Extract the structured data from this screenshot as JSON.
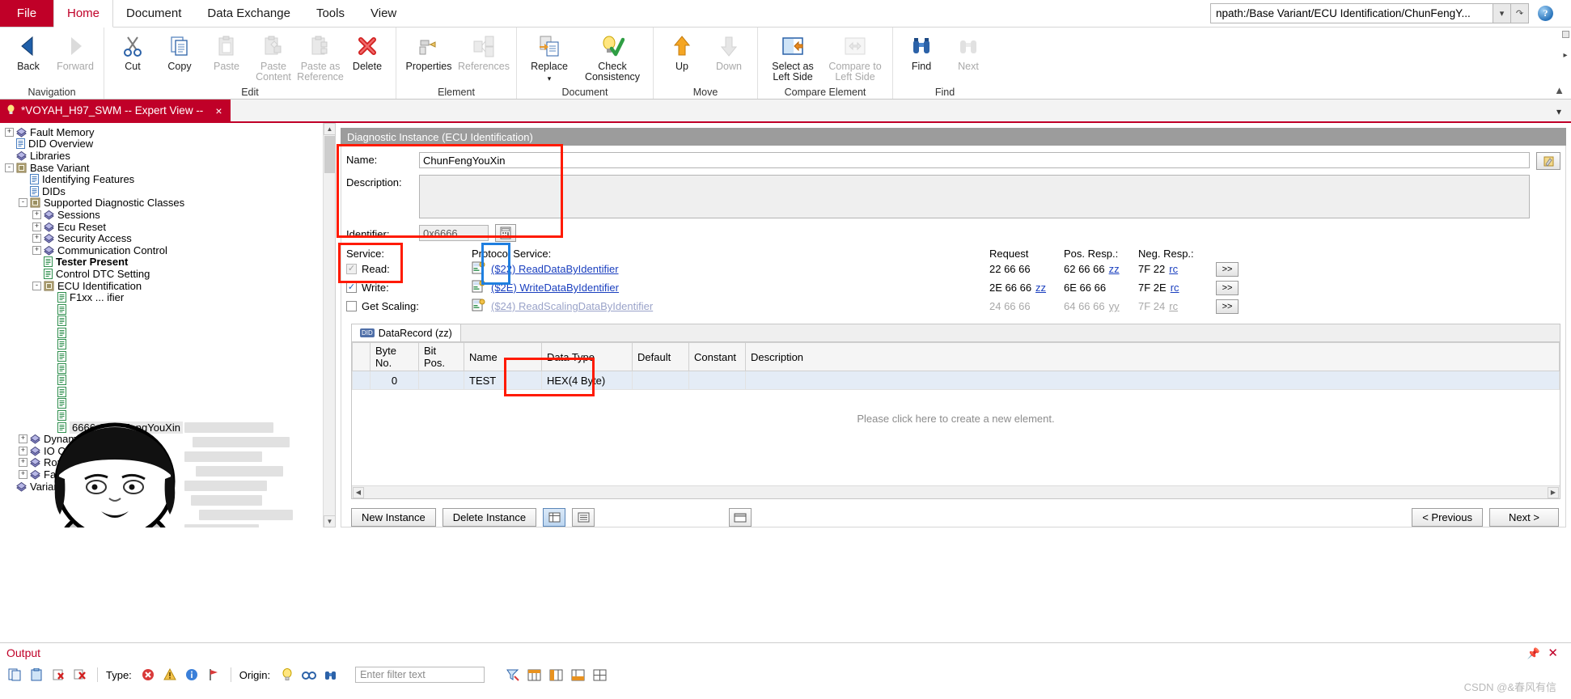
{
  "ribbon": {
    "tabs": [
      {
        "label": "File",
        "type": "file"
      },
      {
        "label": "Home",
        "active": true
      },
      {
        "label": "Document"
      },
      {
        "label": "Data Exchange"
      },
      {
        "label": "Tools"
      },
      {
        "label": "View"
      }
    ],
    "address": {
      "value": "npath:/Base Variant/ECU Identification/ChunFengY...",
      "dropdown_icon": "chevron-down-icon",
      "go_icon": "refresh-icon"
    },
    "help_icon": "help-icon",
    "groups": [
      {
        "title": "Navigation",
        "buttons": [
          {
            "label": "Back",
            "icon": "back-arrow-icon",
            "disabled": false
          },
          {
            "label": "Forward",
            "icon": "forward-arrow-icon",
            "disabled": true
          }
        ]
      },
      {
        "title": "Edit",
        "buttons": [
          {
            "label": "Cut",
            "icon": "scissors-icon",
            "disabled": false
          },
          {
            "label": "Copy",
            "icon": "copy-icon",
            "disabled": false
          },
          {
            "label": "Paste",
            "icon": "paste-icon",
            "disabled": true
          },
          {
            "label": "Paste Content",
            "icon": "paste-content-icon",
            "disabled": true
          },
          {
            "label": "Paste as Reference",
            "icon": "paste-reference-icon",
            "disabled": true
          },
          {
            "label": "Delete",
            "icon": "delete-x-icon",
            "disabled": false
          }
        ]
      },
      {
        "title": "Element",
        "buttons": [
          {
            "label": "Properties",
            "icon": "properties-icon",
            "disabled": false
          },
          {
            "label": "References",
            "icon": "references-icon",
            "disabled": true
          }
        ]
      },
      {
        "title": "Document",
        "buttons": [
          {
            "label": "Replace",
            "icon": "replace-icon",
            "disabled": false,
            "dropdown": true
          },
          {
            "label": "Check Consistency",
            "icon": "check-consistency-icon",
            "disabled": false
          }
        ]
      },
      {
        "title": "Move",
        "buttons": [
          {
            "label": "Up",
            "icon": "arrow-up-icon",
            "disabled": false
          },
          {
            "label": "Down",
            "icon": "arrow-down-icon",
            "disabled": true
          }
        ]
      },
      {
        "title": "Compare Element",
        "buttons": [
          {
            "label": "Select as Left Side",
            "icon": "select-left-icon",
            "disabled": false
          },
          {
            "label": "Compare to Left Side",
            "icon": "compare-left-icon",
            "disabled": true
          }
        ]
      },
      {
        "title": "Find",
        "buttons": [
          {
            "label": "Find",
            "icon": "binoculars-icon",
            "disabled": false
          },
          {
            "label": "Next",
            "icon": "find-next-icon",
            "disabled": true
          }
        ]
      }
    ],
    "collapse_icon": "chevron-up-icon"
  },
  "document_tab": {
    "label": "*VOYAH_H97_SWM -- Expert View --",
    "icon": "bulb-icon",
    "close": "×",
    "overflow_icon": "chevron-down-icon"
  },
  "tree": {
    "items": [
      {
        "label": "Fault Memory",
        "indent": 0,
        "expander": "+",
        "icon": "books-icon"
      },
      {
        "label": "DID Overview",
        "indent": 0,
        "expander": "",
        "icon": "doc-blue-icon"
      },
      {
        "label": "Libraries",
        "indent": 0,
        "expander": "",
        "icon": "books-icon"
      },
      {
        "label": "Base Variant",
        "indent": 0,
        "expander": "-",
        "icon": "variant-icon"
      },
      {
        "label": "Identifying Features",
        "indent": 1,
        "expander": "",
        "icon": "doc-blue-icon"
      },
      {
        "label": "DIDs",
        "indent": 1,
        "expander": "",
        "icon": "doc-blue-icon"
      },
      {
        "label": "Supported Diagnostic Classes",
        "indent": 1,
        "expander": "-",
        "icon": "variant-icon"
      },
      {
        "label": "Sessions",
        "indent": 2,
        "expander": "+",
        "icon": "books-icon"
      },
      {
        "label": "Ecu Reset",
        "indent": 2,
        "expander": "+",
        "icon": "books-icon"
      },
      {
        "label": "Security Access",
        "indent": 2,
        "expander": "+",
        "icon": "books-icon"
      },
      {
        "label": "Communication Control",
        "indent": 2,
        "expander": "+",
        "icon": "books-icon"
      },
      {
        "label": "Tester Present",
        "indent": 2,
        "expander": "",
        "icon": "doc-green-icon",
        "bold": true
      },
      {
        "label": "Control DTC Setting",
        "indent": 2,
        "expander": "",
        "icon": "doc-green-icon"
      },
      {
        "label": "ECU Identification",
        "indent": 2,
        "expander": "-",
        "icon": "variant-icon"
      },
      {
        "label": "F1xx ... ifier",
        "indent": 3,
        "expander": "",
        "icon": "doc-green-icon",
        "obscured": true
      },
      {
        "label": "",
        "indent": 3,
        "expander": "",
        "icon": "doc-green-icon",
        "obscured": true
      },
      {
        "label": "",
        "indent": 3,
        "expander": "",
        "icon": "doc-green-icon",
        "obscured": true
      },
      {
        "label": "",
        "indent": 3,
        "expander": "",
        "icon": "doc-green-icon",
        "obscured": true
      },
      {
        "label": "",
        "indent": 3,
        "expander": "",
        "icon": "doc-green-icon",
        "obscured": true
      },
      {
        "label": "",
        "indent": 3,
        "expander": "",
        "icon": "doc-green-icon",
        "obscured": true
      },
      {
        "label": "",
        "indent": 3,
        "expander": "",
        "icon": "doc-green-icon",
        "obscured": true
      },
      {
        "label": "",
        "indent": 3,
        "expander": "",
        "icon": "doc-green-icon",
        "obscured": true
      },
      {
        "label": "",
        "indent": 3,
        "expander": "",
        "icon": "doc-green-icon",
        "obscured": true
      },
      {
        "label": "",
        "indent": 3,
        "expander": "",
        "icon": "doc-green-icon",
        "obscured": true
      },
      {
        "label": "",
        "indent": 3,
        "expander": "",
        "icon": "doc-green-icon",
        "obscured": true
      },
      {
        "label": "6666 ChunFengYouXin",
        "indent": 3,
        "expander": "",
        "icon": "doc-green-icon",
        "selected": true
      },
      {
        "label": "Dynamic Data",
        "indent": 1,
        "expander": "+",
        "icon": "books-icon"
      },
      {
        "label": "IO Control",
        "indent": 1,
        "expander": "+",
        "icon": "books-icon"
      },
      {
        "label": "Routine Control",
        "indent": 1,
        "expander": "+",
        "icon": "books-icon"
      },
      {
        "label": "Fault Memory",
        "indent": 1,
        "expander": "+",
        "icon": "books-icon"
      },
      {
        "label": "Variants",
        "indent": 0,
        "expander": "",
        "icon": "books-icon"
      }
    ]
  },
  "form": {
    "panel_title": "Diagnostic Instance (ECU Identification)",
    "name_label": "Name:",
    "name_value": "ChunFengYouXin",
    "description_label": "Description:",
    "description_value": "",
    "identifier_label": "Identifier:",
    "identifier_value": "0x6666",
    "identifier_btn_icon": "calculator-icon",
    "edit_icon": "edit-pencil-icon",
    "service_label": "Service:",
    "protocol_service_label": "Protocol Service:",
    "col_request": "Request",
    "col_pos_resp": "Pos. Resp.:",
    "col_neg_resp": "Neg. Resp.:",
    "more_btn": ">>",
    "services": [
      {
        "check_label": "Read:",
        "checked": true,
        "disabled": true,
        "link": "($22) ReadDataByIdentifier",
        "link_icon": "service-read-icon",
        "request": "22  66 66",
        "pos_resp": "62  66 66",
        "pos_suffix": "zz",
        "neg_resp": "7F  22",
        "neg_suffix": "rc",
        "dim": false
      },
      {
        "check_label": "Write:",
        "checked": true,
        "disabled": false,
        "link": "($2E) WriteDataByIdentifier",
        "link_icon": "service-write-icon",
        "request": "2E  66 66",
        "request_suffix": "zz",
        "pos_resp": "6E  66 66",
        "pos_suffix": "",
        "neg_resp": "7F  2E",
        "neg_suffix": "rc",
        "dim": false
      },
      {
        "check_label": "Get Scaling:",
        "checked": false,
        "disabled": false,
        "link": "($24) ReadScalingDataByIdentifier",
        "link_icon": "service-scaling-icon",
        "request": "24  66 66",
        "pos_resp": "64  66 66",
        "pos_suffix": "yy",
        "neg_resp": "7F  24",
        "neg_suffix": "rc",
        "dim": true
      }
    ]
  },
  "datarecord": {
    "tab_label": "DataRecord (zz)",
    "tab_badge": "DID",
    "columns": [
      "",
      "Byte No.",
      "Bit Pos.",
      "Name",
      "Data Type",
      "Default",
      "Constant",
      "Description"
    ],
    "rows": [
      {
        "marker": "",
        "byte_no": "0",
        "bit_pos": "",
        "name": "TEST",
        "data_type": "HEX(4 Byte)",
        "default": "",
        "constant": "",
        "description": ""
      }
    ],
    "empty_hint": "Please click here to create a new element.",
    "scroll_left_icon": "chevron-left-icon",
    "scroll_right_icon": "chevron-right-icon"
  },
  "buttons": {
    "new_instance": "New Instance",
    "delete_instance": "Delete Instance",
    "view_grid_icon": "grid-view-icon",
    "view_list_icon": "list-view-icon",
    "export_icon": "export-icon",
    "previous": "< Previous",
    "next": "Next >"
  },
  "output": {
    "title": "Output",
    "pin_icon": "pin-icon",
    "close_icon": "close-icon",
    "type_label": "Type:",
    "origin_label": "Origin:",
    "filter_placeholder": "Enter filter text",
    "toolbar_icons": [
      "copy-icon",
      "clipboard-icon",
      "clear-icon",
      "clear-all-icon",
      "error-icon",
      "warning-icon",
      "info-icon",
      "flag-red-icon",
      "flag-blue-icon",
      "bulb-icon",
      "glasses-icon",
      "binoculars-icon",
      "filter-icon",
      "table1-icon",
      "table2-icon",
      "table3-icon",
      "table4-icon"
    ]
  },
  "watermark": "CSDN @&春风有信",
  "colors": {
    "brand_red": "#c00028",
    "annotation_red": "#ff1a00",
    "annotation_blue": "#1f7fe0",
    "link_blue": "#1a3fbf",
    "panel_header_gray": "#9c9c9c"
  }
}
